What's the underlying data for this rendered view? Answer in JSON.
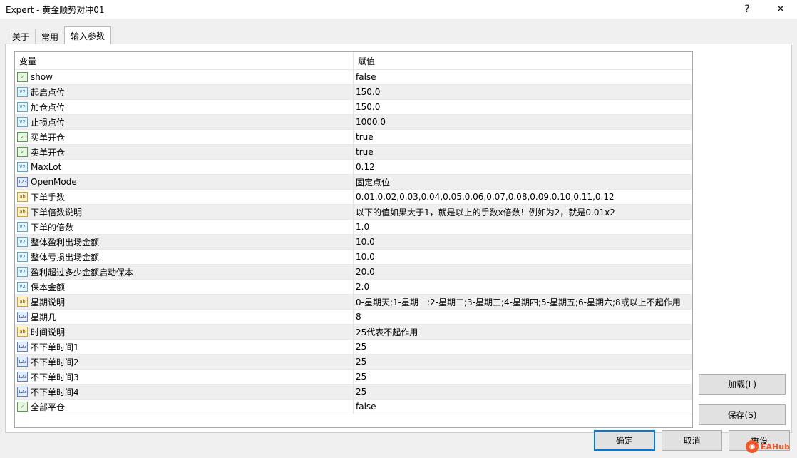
{
  "window": {
    "title": "Expert - 黄金顺势对冲01",
    "help_label": "?",
    "close_label": "✕"
  },
  "tabs": [
    {
      "label": "关于"
    },
    {
      "label": "常用"
    },
    {
      "label": "输入参数"
    }
  ],
  "table": {
    "headers": {
      "variable": "变量",
      "value": "赋值"
    },
    "rows": [
      {
        "icon": "bool",
        "icon_text": "✓",
        "name": "show",
        "value": "false"
      },
      {
        "icon": "dbl",
        "icon_text": "V2",
        "name": "起启点位",
        "value": "150.0"
      },
      {
        "icon": "dbl",
        "icon_text": "V2",
        "name": "加仓点位",
        "value": "150.0"
      },
      {
        "icon": "dbl",
        "icon_text": "V2",
        "name": "止损点位",
        "value": "1000.0"
      },
      {
        "icon": "bool",
        "icon_text": "✓",
        "name": "买单开仓",
        "value": "true"
      },
      {
        "icon": "bool",
        "icon_text": "✓",
        "name": "卖单开仓",
        "value": "true"
      },
      {
        "icon": "dbl",
        "icon_text": "V2",
        "name": "MaxLot",
        "value": "0.12"
      },
      {
        "icon": "int",
        "icon_text": "123",
        "name": "OpenMode",
        "value": "固定点位"
      },
      {
        "icon": "str",
        "icon_text": "ab",
        "name": "下单手数",
        "value": "0.01,0.02,0.03,0.04,0.05,0.06,0.07,0.08,0.09,0.10,0.11,0.12"
      },
      {
        "icon": "str",
        "icon_text": "ab",
        "name": "下单倍数说明",
        "value": "以下的值如果大于1，就是以上的手数x倍数！例如为2，就是0.01x2"
      },
      {
        "icon": "dbl",
        "icon_text": "V2",
        "name": "下单的倍数",
        "value": "1.0"
      },
      {
        "icon": "dbl",
        "icon_text": "V2",
        "name": "整体盈利出场金额",
        "value": "10.0"
      },
      {
        "icon": "dbl",
        "icon_text": "V2",
        "name": "整体亏损出场金额",
        "value": "10.0"
      },
      {
        "icon": "dbl",
        "icon_text": "V2",
        "name": "盈利超过多少金额启动保本",
        "value": "20.0"
      },
      {
        "icon": "dbl",
        "icon_text": "V2",
        "name": "保本金额",
        "value": "2.0"
      },
      {
        "icon": "str",
        "icon_text": "ab",
        "name": "星期说明",
        "value": "0-星期天;1-星期一;2-星期二;3-星期三;4-星期四;5-星期五;6-星期六;8或以上不起作用"
      },
      {
        "icon": "int",
        "icon_text": "123",
        "name": "星期几",
        "value": "8"
      },
      {
        "icon": "str",
        "icon_text": "ab",
        "name": "时间说明",
        "value": "25代表不起作用"
      },
      {
        "icon": "int",
        "icon_text": "123",
        "name": "不下单时间1",
        "value": "25"
      },
      {
        "icon": "int",
        "icon_text": "123",
        "name": "不下单时间2",
        "value": "25"
      },
      {
        "icon": "int",
        "icon_text": "123",
        "name": "不下单时间3",
        "value": "25"
      },
      {
        "icon": "int",
        "icon_text": "123",
        "name": "不下单时间4",
        "value": "25"
      },
      {
        "icon": "bool",
        "icon_text": "✓",
        "name": "全部平仓",
        "value": "false"
      }
    ]
  },
  "buttons": {
    "load": "加载(L)",
    "save": "保存(S)",
    "ok": "确定",
    "cancel": "取消",
    "reset": "重设"
  },
  "watermark": {
    "text": "EAHub"
  }
}
